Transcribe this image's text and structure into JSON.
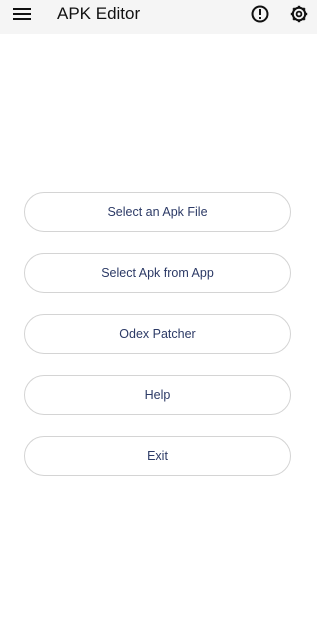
{
  "app_bar": {
    "title": "APK Editor",
    "icons": [
      "menu-icon",
      "info-icon",
      "gear-icon"
    ]
  },
  "menu": {
    "buttons": [
      {
        "label": "Select an Apk File"
      },
      {
        "label": "Select Apk from App"
      },
      {
        "label": "Odex Patcher"
      },
      {
        "label": "Help"
      },
      {
        "label": "Exit"
      }
    ]
  },
  "colors": {
    "app_bar_background": "#f5f5f5",
    "button_text": "#2c3a66",
    "button_border": "#d4d4d4",
    "title_text": "#111111"
  }
}
